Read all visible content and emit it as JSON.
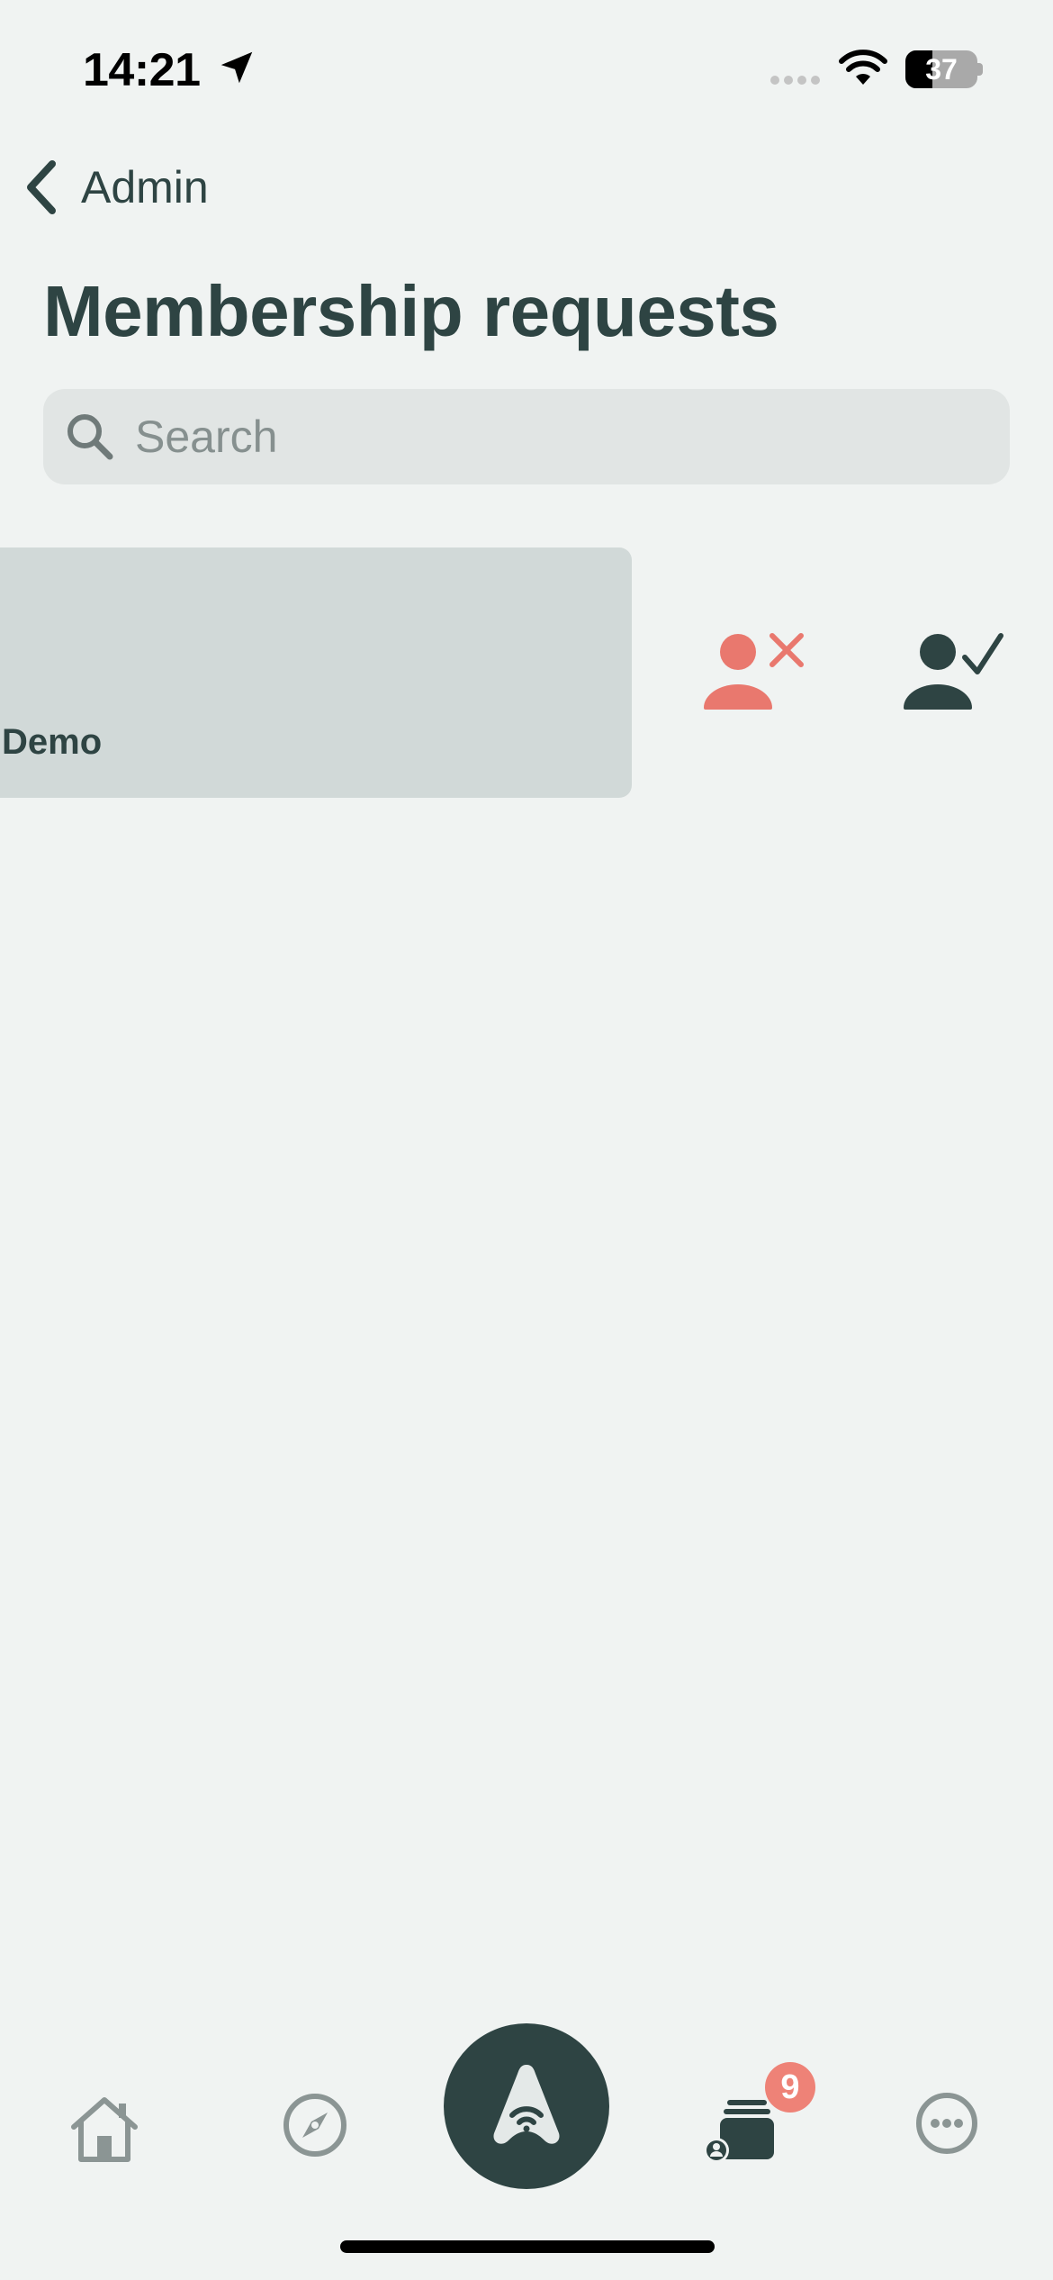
{
  "status_bar": {
    "time": "14:21",
    "battery_level": "37",
    "battery_fraction": 0.37,
    "icons": [
      "location-arrow-icon",
      "signal-icon",
      "wifi-icon",
      "battery-icon"
    ]
  },
  "nav": {
    "back_label": "Admin"
  },
  "page": {
    "title": "Membership requests"
  },
  "search": {
    "placeholder": "Search"
  },
  "requests": [
    {
      "name": "Demo",
      "actions": [
        "decline-member-icon",
        "approve-member-icon"
      ]
    }
  ],
  "tab_bar": {
    "tabs": [
      {
        "name": "home-icon"
      },
      {
        "name": "compass-icon"
      },
      {
        "name": "center-logo-icon"
      },
      {
        "name": "membership-requests-icon",
        "badge": "9"
      },
      {
        "name": "more-icon"
      }
    ]
  },
  "colors": {
    "background": "#f0f3f2",
    "primary": "#2e4443",
    "decline": "#e9786e",
    "badge": "#ee8277",
    "card": "#d1d9d8",
    "search_bg": "#e1e5e4"
  }
}
